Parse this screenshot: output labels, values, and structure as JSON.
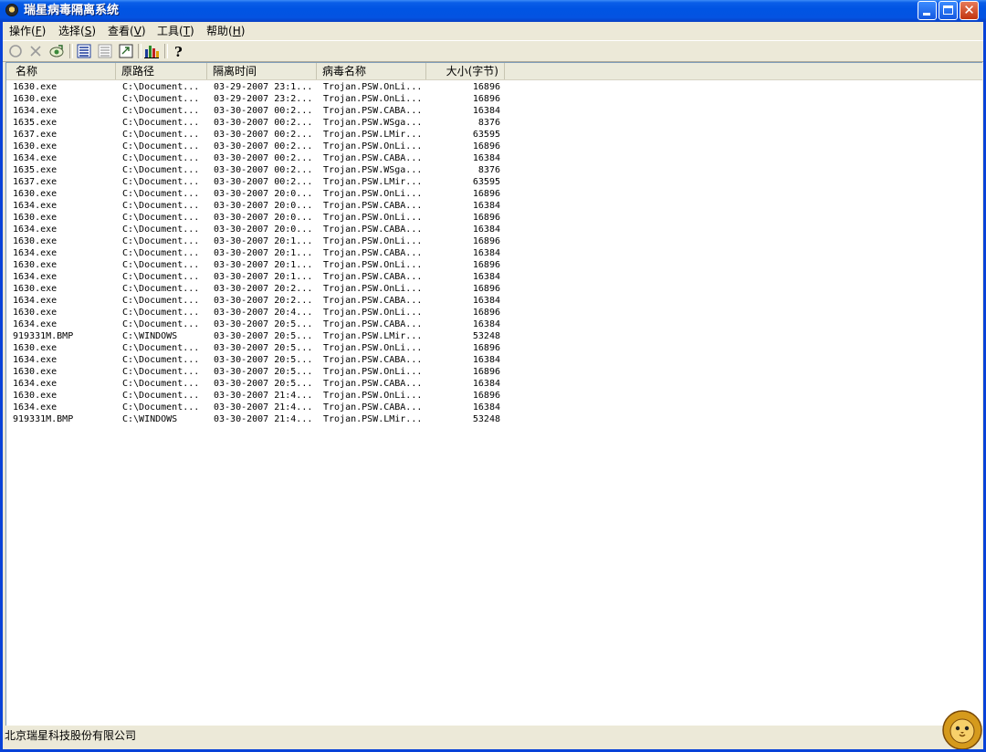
{
  "window": {
    "title": "瑞星病毒隔离系统"
  },
  "menu": [
    {
      "label": "操作",
      "key": "F"
    },
    {
      "label": "选择",
      "key": "S"
    },
    {
      "label": "查看",
      "key": "V"
    },
    {
      "label": "工具",
      "key": "T"
    },
    {
      "label": "帮助",
      "key": "H"
    }
  ],
  "toolbar": {
    "icons": [
      "restore-icon",
      "delete-icon",
      "add-file-icon",
      "details-view-icon",
      "list-view-icon",
      "refresh-icon",
      "statistics-icon",
      "help-icon"
    ]
  },
  "columns": [
    "名称",
    "原路径",
    "隔离时间",
    "病毒名称",
    "大小(字节)"
  ],
  "rows": [
    {
      "name": "1630.exe",
      "path": "C:\\Document...",
      "time": "03-29-2007 23:1...",
      "virus": "Trojan.PSW.OnLi...",
      "size": "16896"
    },
    {
      "name": "1630.exe",
      "path": "C:\\Document...",
      "time": "03-29-2007 23:2...",
      "virus": "Trojan.PSW.OnLi...",
      "size": "16896"
    },
    {
      "name": "1634.exe",
      "path": "C:\\Document...",
      "time": "03-30-2007 00:2...",
      "virus": "Trojan.PSW.CABA...",
      "size": "16384"
    },
    {
      "name": "1635.exe",
      "path": "C:\\Document...",
      "time": "03-30-2007 00:2...",
      "virus": "Trojan.PSW.WSga...",
      "size": "8376"
    },
    {
      "name": "1637.exe",
      "path": "C:\\Document...",
      "time": "03-30-2007 00:2...",
      "virus": "Trojan.PSW.LMir...",
      "size": "63595"
    },
    {
      "name": "1630.exe",
      "path": "C:\\Document...",
      "time": "03-30-2007 00:2...",
      "virus": "Trojan.PSW.OnLi...",
      "size": "16896"
    },
    {
      "name": "1634.exe",
      "path": "C:\\Document...",
      "time": "03-30-2007 00:2...",
      "virus": "Trojan.PSW.CABA...",
      "size": "16384"
    },
    {
      "name": "1635.exe",
      "path": "C:\\Document...",
      "time": "03-30-2007 00:2...",
      "virus": "Trojan.PSW.WSga...",
      "size": "8376"
    },
    {
      "name": "1637.exe",
      "path": "C:\\Document...",
      "time": "03-30-2007 00:2...",
      "virus": "Trojan.PSW.LMir...",
      "size": "63595"
    },
    {
      "name": "1630.exe",
      "path": "C:\\Document...",
      "time": "03-30-2007 20:0...",
      "virus": "Trojan.PSW.OnLi...",
      "size": "16896"
    },
    {
      "name": "1634.exe",
      "path": "C:\\Document...",
      "time": "03-30-2007 20:0...",
      "virus": "Trojan.PSW.CABA...",
      "size": "16384"
    },
    {
      "name": "1630.exe",
      "path": "C:\\Document...",
      "time": "03-30-2007 20:0...",
      "virus": "Trojan.PSW.OnLi...",
      "size": "16896"
    },
    {
      "name": "1634.exe",
      "path": "C:\\Document...",
      "time": "03-30-2007 20:0...",
      "virus": "Trojan.PSW.CABA...",
      "size": "16384"
    },
    {
      "name": "1630.exe",
      "path": "C:\\Document...",
      "time": "03-30-2007 20:1...",
      "virus": "Trojan.PSW.OnLi...",
      "size": "16896"
    },
    {
      "name": "1634.exe",
      "path": "C:\\Document...",
      "time": "03-30-2007 20:1...",
      "virus": "Trojan.PSW.CABA...",
      "size": "16384"
    },
    {
      "name": "1630.exe",
      "path": "C:\\Document...",
      "time": "03-30-2007 20:1...",
      "virus": "Trojan.PSW.OnLi...",
      "size": "16896"
    },
    {
      "name": "1634.exe",
      "path": "C:\\Document...",
      "time": "03-30-2007 20:1...",
      "virus": "Trojan.PSW.CABA...",
      "size": "16384"
    },
    {
      "name": "1630.exe",
      "path": "C:\\Document...",
      "time": "03-30-2007 20:2...",
      "virus": "Trojan.PSW.OnLi...",
      "size": "16896"
    },
    {
      "name": "1634.exe",
      "path": "C:\\Document...",
      "time": "03-30-2007 20:2...",
      "virus": "Trojan.PSW.CABA...",
      "size": "16384"
    },
    {
      "name": "1630.exe",
      "path": "C:\\Document...",
      "time": "03-30-2007 20:4...",
      "virus": "Trojan.PSW.OnLi...",
      "size": "16896"
    },
    {
      "name": "1634.exe",
      "path": "C:\\Document...",
      "time": "03-30-2007 20:5...",
      "virus": "Trojan.PSW.CABA...",
      "size": "16384"
    },
    {
      "name": "919331M.BMP",
      "path": "C:\\WINDOWS",
      "time": "03-30-2007 20:5...",
      "virus": "Trojan.PSW.LMir...",
      "size": "53248"
    },
    {
      "name": "1630.exe",
      "path": "C:\\Document...",
      "time": "03-30-2007 20:5...",
      "virus": "Trojan.PSW.OnLi...",
      "size": "16896"
    },
    {
      "name": "1634.exe",
      "path": "C:\\Document...",
      "time": "03-30-2007 20:5...",
      "virus": "Trojan.PSW.CABA...",
      "size": "16384"
    },
    {
      "name": "1630.exe",
      "path": "C:\\Document...",
      "time": "03-30-2007 20:5...",
      "virus": "Trojan.PSW.OnLi...",
      "size": "16896"
    },
    {
      "name": "1634.exe",
      "path": "C:\\Document...",
      "time": "03-30-2007 20:5...",
      "virus": "Trojan.PSW.CABA...",
      "size": "16384"
    },
    {
      "name": "1630.exe",
      "path": "C:\\Document...",
      "time": "03-30-2007 21:4...",
      "virus": "Trojan.PSW.OnLi...",
      "size": "16896"
    },
    {
      "name": "1634.exe",
      "path": "C:\\Document...",
      "time": "03-30-2007 21:4...",
      "virus": "Trojan.PSW.CABA...",
      "size": "16384"
    },
    {
      "name": "919331M.BMP",
      "path": "C:\\WINDOWS",
      "time": "03-30-2007 21:4...",
      "virus": "Trojan.PSW.LMir...",
      "size": "53248"
    }
  ],
  "status": {
    "text": "北京瑞星科技股份有限公司"
  },
  "colors": {
    "titlebar": "#0054e3",
    "frame": "#0842d8",
    "face": "#ece9d8",
    "list_bg": "#ffffff"
  }
}
